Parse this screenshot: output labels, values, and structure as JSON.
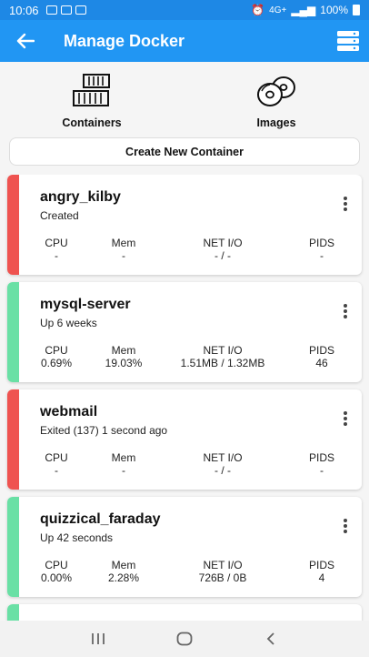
{
  "status_bar": {
    "time": "10:06",
    "signal": "4G+",
    "battery": "100%"
  },
  "app_bar": {
    "title": "Manage Docker"
  },
  "segments": [
    {
      "label": "Containers",
      "icon": "containers-icon"
    },
    {
      "label": "Images",
      "icon": "images-icon"
    }
  ],
  "create_button": {
    "label": "Create New Container"
  },
  "stat_labels": {
    "cpu": "CPU",
    "mem": "Mem",
    "net": "NET I/O",
    "pids": "PIDS"
  },
  "containers": [
    {
      "name": "angry_kilby",
      "status": "Created",
      "state_color": "#ef5350",
      "cpu": "-",
      "mem": "-",
      "net": "- / -",
      "pids": "-"
    },
    {
      "name": "mysql-server",
      "status": "Up 6 weeks",
      "state_color": "#69e0a5",
      "cpu": "0.69%",
      "mem": "19.03%",
      "net": "1.51MB / 1.32MB",
      "pids": "46"
    },
    {
      "name": "webmail",
      "status": "Exited (137) 1 second ago",
      "state_color": "#ef5350",
      "cpu": "-",
      "mem": "-",
      "net": "- / -",
      "pids": "-"
    },
    {
      "name": "quizzical_faraday",
      "status": "Up 42 seconds",
      "state_color": "#69e0a5",
      "cpu": "0.00%",
      "mem": "2.28%",
      "net": "726B / 0B",
      "pids": "4"
    }
  ],
  "partial_card": {
    "state_color": "#69e0a5"
  }
}
